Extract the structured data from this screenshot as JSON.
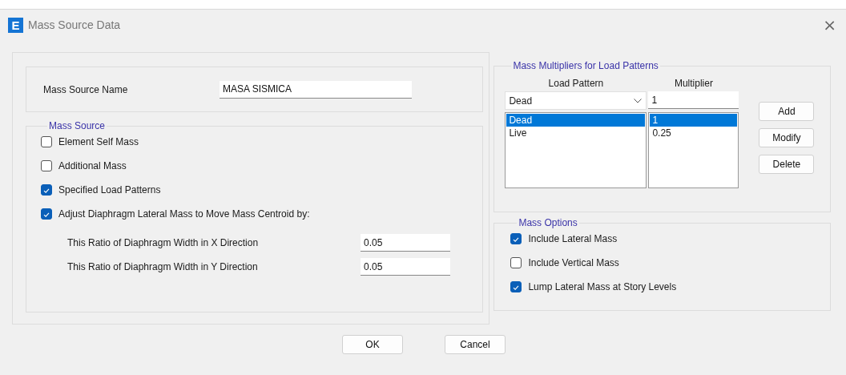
{
  "window": {
    "title": "Mass Source Data",
    "icon_letter": "E",
    "close": "×"
  },
  "mass_source_name": {
    "label": "Mass Source Name",
    "value": "MASA SISMICA"
  },
  "mass_source": {
    "title": "Mass Source",
    "options": [
      {
        "label": "Element Self Mass",
        "checked": false
      },
      {
        "label": "Additional Mass",
        "checked": false
      },
      {
        "label": "Specified Load Patterns",
        "checked": true
      },
      {
        "label": "Adjust Diaphragm Lateral Mass to Move Mass Centroid by:",
        "checked": true
      }
    ],
    "ratios": [
      {
        "label": "This Ratio of Diaphragm Width in X Direction",
        "value": "0.05"
      },
      {
        "label": "This Ratio of Diaphragm Width in Y Direction",
        "value": "0.05"
      }
    ]
  },
  "mass_multipliers": {
    "title": "Mass Multipliers for Load Patterns",
    "columns": [
      "Load Pattern",
      "Multiplier"
    ],
    "pattern_select": "Dead",
    "multiplier_input": "1",
    "rows": [
      {
        "load_pattern": "Dead",
        "multiplier": "1",
        "selected": true
      },
      {
        "load_pattern": "Live",
        "multiplier": "0.25",
        "selected": false
      }
    ],
    "buttons": [
      "Add",
      "Modify",
      "Delete"
    ]
  },
  "mass_options": {
    "title": "Mass Options",
    "options": [
      {
        "label": "Include Lateral Mass",
        "checked": true
      },
      {
        "label": "Include Vertical Mass",
        "checked": false
      },
      {
        "label": "Lump Lateral Mass at Story Levels",
        "checked": true
      }
    ]
  },
  "buttons": [
    "OK",
    "Cancel"
  ]
}
